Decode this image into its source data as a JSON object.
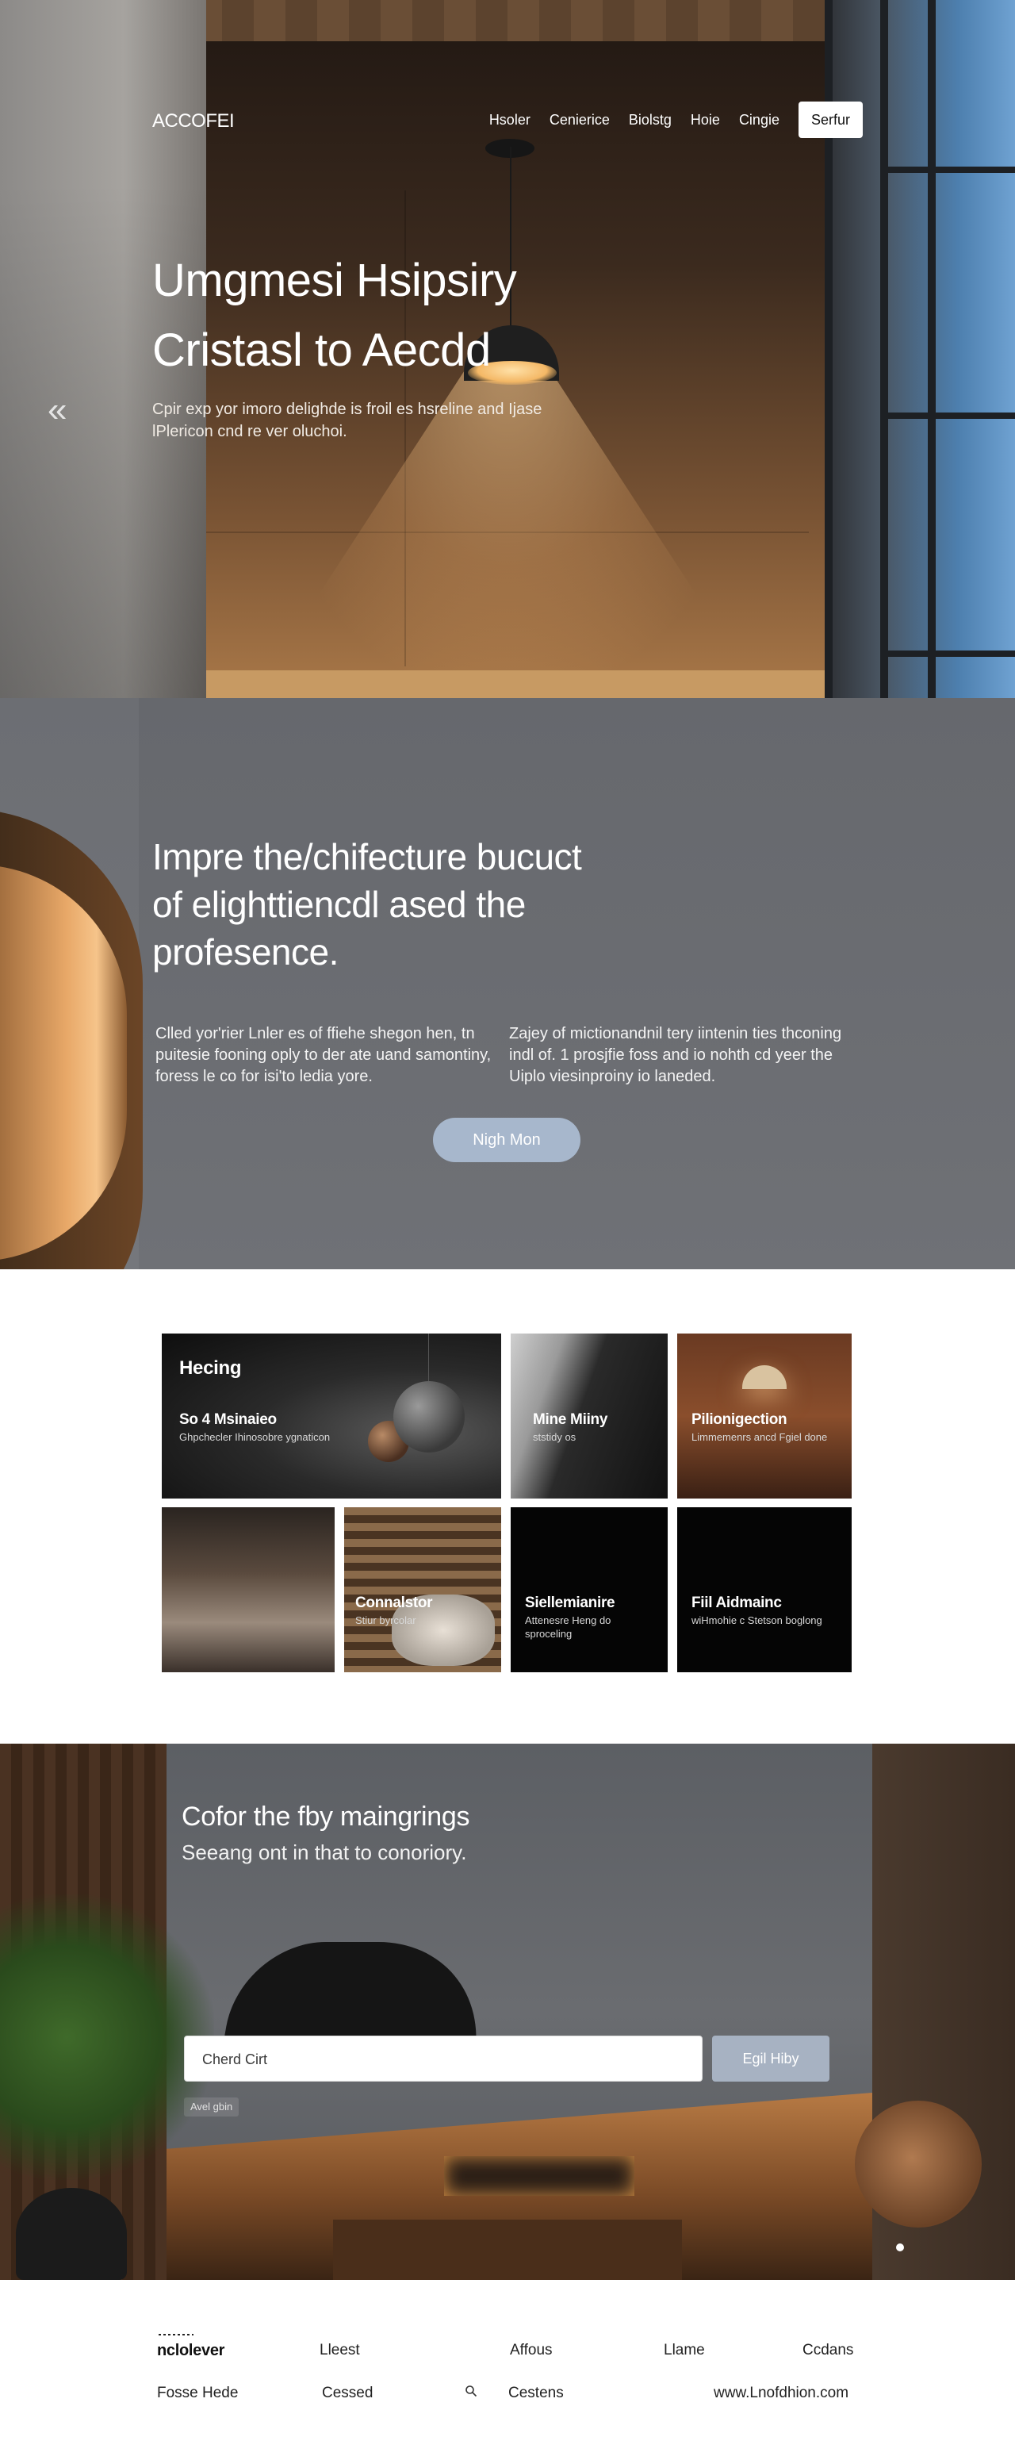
{
  "nav": {
    "logo": "ACCOFEI",
    "links": [
      "Hsoler",
      "Cenierice",
      "Biolstg",
      "Hoie",
      "Cingie"
    ],
    "cta": "Serfur"
  },
  "hero": {
    "title_line1": "Umgmesi Hsipsiry",
    "title_line2": "Cristasl to Aecdd",
    "subtitle": "Cpir exp yor imoro delighde is froil es hsreline and Ijase lPlericon cnd re ver oluchoi.",
    "prev_arrow": "«"
  },
  "about": {
    "heading": "Impre the/chifecture bucuct of elighttiencdl ased the profesence.",
    "col1": "Clled yor'rier Lnler es of ffiehe shegon hen, tn puitesie fooning oply to der ate uand samontiny, foress le co for isi'to ledia yore.",
    "col2": "Zajey of mictionandnil tery iintenin ties thconing indl of. 1 prosjfie foss and io nohth cd yeer the Uiplo viesinproiny io laneded.",
    "button": "Nigh Mon"
  },
  "gallery": {
    "tiles": [
      {
        "title": "Hecing",
        "subtitle": "So 4 Msinaieo",
        "desc": "Ghpchecler Ihinosobre ygnaticon"
      },
      {
        "title": "Mine Miiny",
        "desc": "ststidy os"
      },
      {
        "title": "Pilionigection",
        "desc": "Limmemenrs ancd Fgiel done"
      },
      {
        "title": "",
        "desc": ""
      },
      {
        "title": "Connalstor",
        "desc": "Stiur byrcolar"
      },
      {
        "title": "Siellemianire",
        "desc": "Attenesre Heng do sproceling"
      },
      {
        "title": "Fiil Aidmainc",
        "desc": "wiHmohie c Stetson boglong"
      }
    ]
  },
  "cta": {
    "heading": "Cofor the fby maingrings",
    "tagline": "Seeang ont in that to conoriory.",
    "input_placeholder": "Cherd Cirt",
    "submit": "Egil Hiby",
    "hint": "Avel gbin"
  },
  "footer": {
    "brand": "nclolever",
    "row1": [
      "Lleest",
      "Affous",
      "Llame",
      "Ccdans"
    ],
    "row2_left": "Fosse Hede",
    "row2": [
      "Cessed",
      "Cestens"
    ],
    "website": "www.Lnofdhion.com"
  },
  "colors": {
    "accent_button": "#a7b7cc",
    "submit_button": "#a7b2c2",
    "section_grey": "#6f7176"
  }
}
